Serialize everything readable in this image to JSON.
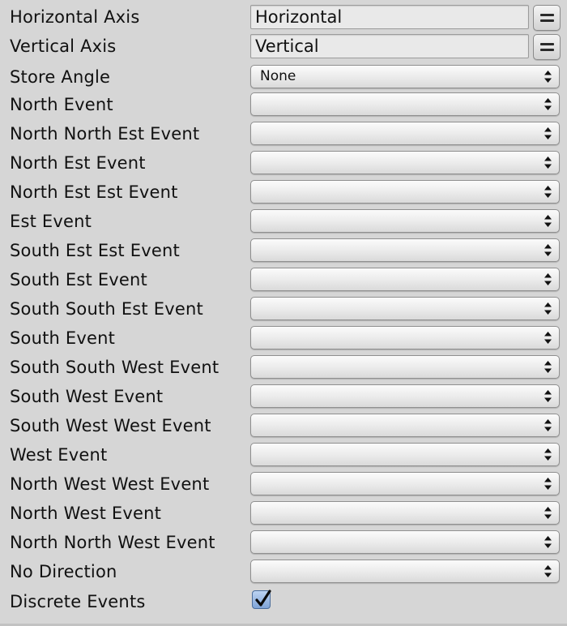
{
  "fields": {
    "horizontal_axis": {
      "label": "Horizontal Axis",
      "value": "Horizontal"
    },
    "vertical_axis": {
      "label": "Vertical Axis",
      "value": "Vertical"
    },
    "store_angle": {
      "label": "Store Angle",
      "value": "None"
    }
  },
  "events": [
    {
      "label": "North Event",
      "value": ""
    },
    {
      "label": "North North Est Event",
      "value": ""
    },
    {
      "label": "North Est Event",
      "value": ""
    },
    {
      "label": "North Est Est Event",
      "value": ""
    },
    {
      "label": "Est Event",
      "value": ""
    },
    {
      "label": "South Est Est Event",
      "value": ""
    },
    {
      "label": "South Est Event",
      "value": ""
    },
    {
      "label": "South South Est Event",
      "value": ""
    },
    {
      "label": "South Event",
      "value": ""
    },
    {
      "label": "South South West Event",
      "value": ""
    },
    {
      "label": "South West Event",
      "value": ""
    },
    {
      "label": "South West West Event",
      "value": ""
    },
    {
      "label": "West Event",
      "value": ""
    },
    {
      "label": "North West West Event",
      "value": ""
    },
    {
      "label": "North West Event",
      "value": ""
    },
    {
      "label": "North North West Event",
      "value": ""
    },
    {
      "label": "No Direction",
      "value": ""
    }
  ],
  "discrete_events": {
    "label": "Discrete Events",
    "checked": true
  },
  "icons": {
    "menu_button": "equals-menu-icon",
    "dropdown_arrows": "up-down-arrows-icon",
    "check": "checkmark-icon"
  },
  "colors": {
    "background": "#d6d6d6",
    "checkbox_fill": "#9dbbe6"
  }
}
